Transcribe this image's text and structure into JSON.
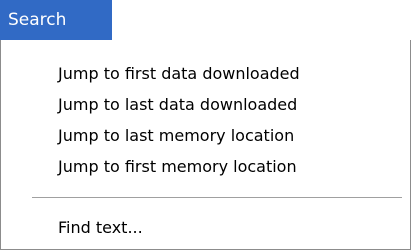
{
  "menu": {
    "title": "Search",
    "items": [
      {
        "label": "Jump to first data downloaded"
      },
      {
        "label": "Jump to last data downloaded"
      },
      {
        "label": "Jump to last memory location"
      },
      {
        "label": "Jump to first memory location"
      },
      {
        "label": "Find text..."
      }
    ],
    "highlight_color": "#316ac5"
  }
}
